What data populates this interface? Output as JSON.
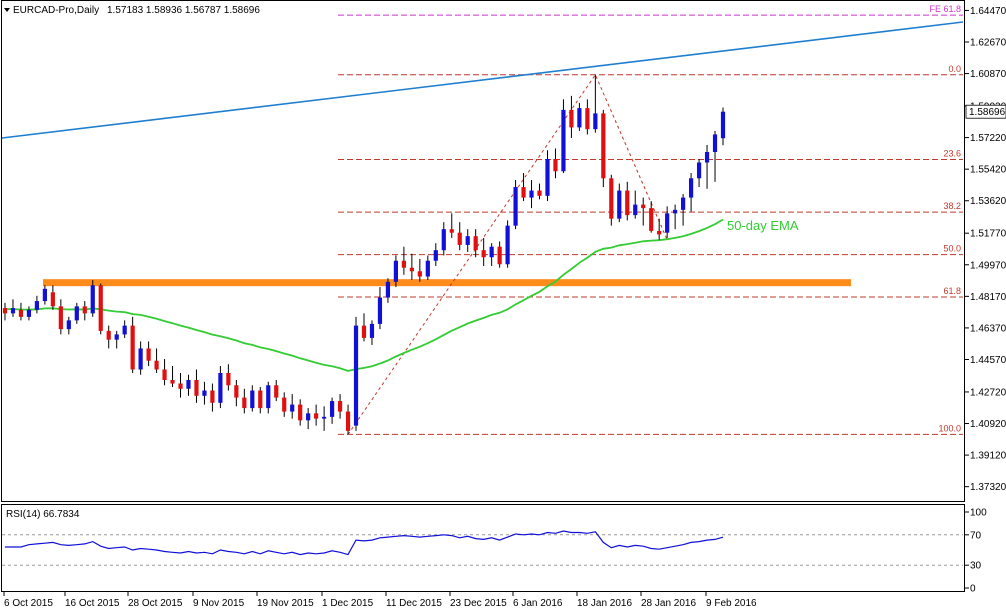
{
  "chart_data": {
    "type": "candlestick",
    "symbol_header": "EURCAD-Pro,Daily",
    "ohlc_header": "1.57183 1.58936 1.56787 1.58696",
    "last_price_label": "1.58696",
    "colors": {
      "up": "#1010d8",
      "down": "#e01010",
      "ema": "#33cc33",
      "trendline": "#1e7fd0",
      "fib": "#c0392b",
      "fe": "#cc33cc",
      "zone": "#ff8c1a",
      "rsi": "#1010d8"
    },
    "price_axis": {
      "ylim": [
        1.3656,
        1.6495
      ],
      "ticks": [
        "1.64470",
        "1.62670",
        "1.60870",
        "1.59020",
        "1.57220",
        "1.55420",
        "1.53620",
        "1.51770",
        "1.49970",
        "1.48170",
        "1.46370",
        "1.44570",
        "1.42720",
        "1.40920",
        "1.39120",
        "1.37320"
      ]
    },
    "x_axis": {
      "ticks": [
        "6 Oct 2015",
        "16 Oct 2015",
        "28 Oct 2015",
        "9 Nov 2015",
        "19 Nov 2015",
        "1 Dec 2015",
        "11 Dec 2015",
        "23 Dec 2015",
        "6 Jan 2016",
        "18 Jan 2016",
        "28 Jan 2016",
        "9 Feb 2016"
      ]
    },
    "candles": [
      [
        1.475,
        1.478,
        1.468,
        1.472
      ],
      [
        1.472,
        1.48,
        1.47,
        1.475
      ],
      [
        1.474,
        1.478,
        1.468,
        1.47
      ],
      [
        1.47,
        1.476,
        1.468,
        1.474
      ],
      [
        1.474,
        1.482,
        1.472,
        1.479
      ],
      [
        1.479,
        1.488,
        1.477,
        1.486
      ],
      [
        1.484,
        1.488,
        1.474,
        1.476
      ],
      [
        1.476,
        1.48,
        1.46,
        1.463
      ],
      [
        1.463,
        1.47,
        1.46,
        1.468
      ],
      [
        1.468,
        1.478,
        1.466,
        1.476
      ],
      [
        1.476,
        1.479,
        1.468,
        1.472
      ],
      [
        1.472,
        1.491,
        1.47,
        1.488
      ],
      [
        1.488,
        1.489,
        1.46,
        1.462
      ],
      [
        1.462,
        1.465,
        1.452,
        1.457
      ],
      [
        1.457,
        1.462,
        1.452,
        1.46
      ],
      [
        1.46,
        1.468,
        1.458,
        1.465
      ],
      [
        1.465,
        1.47,
        1.438,
        1.44
      ],
      [
        1.44,
        1.456,
        1.437,
        1.452
      ],
      [
        1.452,
        1.456,
        1.442,
        1.445
      ],
      [
        1.445,
        1.452,
        1.438,
        1.44
      ],
      [
        1.44,
        1.446,
        1.431,
        1.434
      ],
      [
        1.434,
        1.442,
        1.43,
        1.432
      ],
      [
        1.432,
        1.438,
        1.424,
        1.429
      ],
      [
        1.429,
        1.437,
        1.425,
        1.434
      ],
      [
        1.434,
        1.44,
        1.421,
        1.425
      ],
      [
        1.425,
        1.433,
        1.42,
        1.428
      ],
      [
        1.428,
        1.432,
        1.416,
        1.421
      ],
      [
        1.421,
        1.442,
        1.418,
        1.438
      ],
      [
        1.438,
        1.443,
        1.428,
        1.431
      ],
      [
        1.431,
        1.434,
        1.419,
        1.424
      ],
      [
        1.424,
        1.429,
        1.415,
        1.418
      ],
      [
        1.418,
        1.431,
        1.416,
        1.428
      ],
      [
        1.428,
        1.43,
        1.415,
        1.418
      ],
      [
        1.418,
        1.433,
        1.415,
        1.431
      ],
      [
        1.431,
        1.434,
        1.422,
        1.424
      ],
      [
        1.424,
        1.427,
        1.413,
        1.416
      ],
      [
        1.416,
        1.426,
        1.412,
        1.42
      ],
      [
        1.42,
        1.423,
        1.408,
        1.411
      ],
      [
        1.411,
        1.418,
        1.406,
        1.415
      ],
      [
        1.415,
        1.42,
        1.408,
        1.412
      ],
      [
        1.412,
        1.419,
        1.405,
        1.413
      ],
      [
        1.413,
        1.424,
        1.409,
        1.422
      ],
      [
        1.422,
        1.426,
        1.412,
        1.416
      ],
      [
        1.416,
        1.42,
        1.403,
        1.405
      ],
      [
        1.408,
        1.47,
        1.405,
        1.465
      ],
      [
        1.465,
        1.472,
        1.456,
        1.458
      ],
      [
        1.458,
        1.468,
        1.454,
        1.466
      ],
      [
        1.466,
        1.487,
        1.463,
        1.481
      ],
      [
        1.481,
        1.492,
        1.478,
        1.49
      ],
      [
        1.49,
        1.505,
        1.487,
        1.502
      ],
      [
        1.502,
        1.51,
        1.494,
        1.498
      ],
      [
        1.498,
        1.506,
        1.491,
        1.496
      ],
      [
        1.496,
        1.503,
        1.49,
        1.493
      ],
      [
        1.493,
        1.505,
        1.491,
        1.502
      ],
      [
        1.502,
        1.512,
        1.499,
        1.508
      ],
      [
        1.508,
        1.524,
        1.505,
        1.52
      ],
      [
        1.52,
        1.529,
        1.515,
        1.518
      ],
      [
        1.518,
        1.524,
        1.508,
        1.511
      ],
      [
        1.511,
        1.52,
        1.507,
        1.516
      ],
      [
        1.516,
        1.52,
        1.504,
        1.508
      ],
      [
        1.508,
        1.515,
        1.499,
        1.504
      ],
      [
        1.504,
        1.512,
        1.499,
        1.51
      ],
      [
        1.51,
        1.513,
        1.498,
        1.5
      ],
      [
        1.5,
        1.525,
        1.498,
        1.522
      ],
      [
        1.522,
        1.548,
        1.52,
        1.544
      ],
      [
        1.544,
        1.552,
        1.536,
        1.538
      ],
      [
        1.538,
        1.548,
        1.532,
        1.542
      ],
      [
        1.542,
        1.546,
        1.537,
        1.539
      ],
      [
        1.539,
        1.565,
        1.536,
        1.56
      ],
      [
        1.56,
        1.566,
        1.549,
        1.553
      ],
      [
        1.553,
        1.594,
        1.552,
        1.588
      ],
      [
        1.588,
        1.596,
        1.572,
        1.578
      ],
      [
        1.578,
        1.592,
        1.576,
        1.589
      ],
      [
        1.589,
        1.594,
        1.574,
        1.577
      ],
      [
        1.577,
        1.608,
        1.575,
        1.586
      ],
      [
        1.586,
        1.588,
        1.544,
        1.549
      ],
      [
        1.549,
        1.551,
        1.522,
        1.526
      ],
      [
        1.526,
        1.546,
        1.524,
        1.542
      ],
      [
        1.542,
        1.547,
        1.525,
        1.528
      ],
      [
        1.528,
        1.542,
        1.526,
        1.534
      ],
      [
        1.534,
        1.538,
        1.522,
        1.532
      ],
      [
        1.532,
        1.536,
        1.518,
        1.519
      ],
      [
        1.519,
        1.526,
        1.514,
        1.517
      ],
      [
        1.518,
        1.533,
        1.515,
        1.529
      ],
      [
        1.529,
        1.534,
        1.52,
        1.531
      ],
      [
        1.531,
        1.54,
        1.522,
        1.538
      ],
      [
        1.538,
        1.552,
        1.53,
        1.549
      ],
      [
        1.549,
        1.56,
        1.544,
        1.558
      ],
      [
        1.558,
        1.568,
        1.543,
        1.564
      ],
      [
        1.564,
        1.576,
        1.547,
        1.574
      ],
      [
        1.57183,
        1.58936,
        1.56787,
        1.58696
      ]
    ],
    "ema_50": [
      1.4745,
      1.4744,
      1.4742,
      1.4741,
      1.4743,
      1.4748,
      1.4749,
      1.4744,
      1.4742,
      1.4743,
      1.4742,
      1.4748,
      1.4743,
      1.4736,
      1.473,
      1.4727,
      1.4716,
      1.4711,
      1.4701,
      1.4689,
      1.4676,
      1.4664,
      1.465,
      1.4639,
      1.4625,
      1.4613,
      1.4599,
      1.459,
      1.4578,
      1.4565,
      1.455,
      1.454,
      1.4526,
      1.4517,
      1.4505,
      1.4491,
      1.4479,
      1.4464,
      1.4451,
      1.4438,
      1.4426,
      1.4418,
      1.4407,
      1.4392,
      1.4402,
      1.4409,
      1.4419,
      1.4434,
      1.4451,
      1.4474,
      1.4494,
      1.4513,
      1.453,
      1.455,
      1.4572,
      1.4597,
      1.4621,
      1.4641,
      1.4662,
      1.4679,
      1.4694,
      1.4711,
      1.4723,
      1.4743,
      1.4771,
      1.4795,
      1.482,
      1.4843,
      1.4874,
      1.4901,
      1.494,
      1.4973,
      1.5008,
      1.5038,
      1.5071,
      1.5088,
      1.5095,
      1.5108,
      1.5115,
      1.5123,
      1.5131,
      1.5135,
      1.5137,
      1.5143,
      1.515,
      1.516,
      1.5173,
      1.5189,
      1.5207,
      1.5228,
      1.5255
    ],
    "fib_levels": [
      {
        "label": "0.0",
        "value": 1.608
      },
      {
        "label": "23.6",
        "value": 1.5597
      },
      {
        "label": "38.2",
        "value": 1.5297
      },
      {
        "label": "50.0",
        "value": 1.5055
      },
      {
        "label": "61.8",
        "value": 1.4813
      },
      {
        "label": "100.0",
        "value": 1.403
      }
    ],
    "fe_level": {
      "label": "FE 61.8",
      "value": 1.642
    },
    "resistance_zone": {
      "from": 1.4915,
      "to": 1.4875
    },
    "ema_label": "50-day EMA",
    "rsi": {
      "label": "RSI(14) 66.7834",
      "ticks": [
        "100",
        "70",
        "30",
        "0"
      ],
      "levels": [
        70,
        30
      ],
      "values": [
        54,
        54,
        54,
        57,
        58,
        59,
        60,
        57,
        56,
        57,
        58,
        61,
        55,
        52,
        53,
        54,
        50,
        52,
        51,
        50,
        48,
        47,
        46,
        48,
        46,
        47,
        45,
        50,
        48,
        47,
        45,
        48,
        45,
        49,
        47,
        45,
        47,
        44,
        46,
        45,
        46,
        49,
        47,
        44,
        63,
        62,
        63,
        66,
        67,
        68,
        69,
        68,
        67,
        68,
        69,
        70,
        69,
        66,
        68,
        65,
        64,
        66,
        63,
        67,
        71,
        70,
        71,
        70,
        73,
        72,
        75,
        73,
        73,
        72,
        74,
        60,
        53,
        56,
        54,
        56,
        55,
        52,
        51,
        53,
        55,
        57,
        60,
        61,
        63,
        64,
        66.78
      ]
    }
  }
}
